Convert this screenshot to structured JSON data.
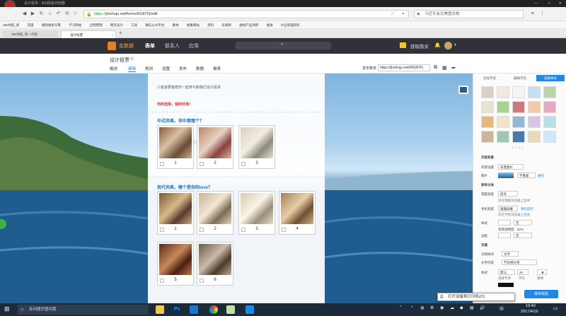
{
  "window": {
    "title": "设计投票 - 360极速浏览器"
  },
  "address": {
    "scheme": "https://",
    "url": "jinshuju.net/forms/6G87Fj/edit",
    "search_text": "习近平会见美国总统"
  },
  "bookmarks": [
    "360导航_新",
    "百度",
    "搜狗搜索引擎",
    "学习网站",
    "全网营销",
    "网页设计",
    "工具",
    "微信公众平台",
    "素材",
    "搜集网站",
    "资料",
    "乐视频",
    "虚拟产品项目",
    "金融",
    "众业管理资料"
  ],
  "tabs": [
    {
      "label": "360导航_新一代安"
    },
    {
      "label": "设计投票"
    }
  ],
  "app": {
    "logo_text": "金数据",
    "nav": [
      "表单",
      "联系人",
      "应用"
    ],
    "upgrade": "获取购买",
    "title": "设计投票",
    "subnav": [
      "概述",
      "编辑",
      "规则",
      "设置",
      "发布",
      "数据",
      "报表"
    ],
    "publish_label": "发布表单",
    "publish_url": "https://jinshuju.net/f/6G87Fj"
  },
  "form": {
    "intro": "小金家要装修你一起参与和我们设计投票",
    "notice": "你的选择，我的环境！",
    "q1": {
      "title": "中式风格，你中意哪个？",
      "options": [
        "1",
        "2",
        "3"
      ]
    },
    "q2": {
      "title": "现代风格，哪个是你的love？",
      "options": [
        "1",
        "2",
        "3",
        "4",
        "5",
        "6"
      ]
    }
  },
  "panel": {
    "tabs": [
      "添加字段",
      "编辑字段",
      "皮肤样式"
    ],
    "page_bg_title": "页面背景",
    "bg_label": "背景设置",
    "bg_value": "背景图片",
    "image_label": "图片",
    "image_mode": "不重复",
    "image_delete": "删除",
    "form_bg_title": "表单主体",
    "body_width_label": "电脑宽度",
    "body_width_value": "较窄",
    "note1": "仅在电脑浏览器上生效",
    "mobile_label": "手机宽度",
    "mobile_value": "铺满屏幕",
    "mobile_link": "预览提示",
    "note2": "仅在手机浏览器上生效",
    "style_label": "样式",
    "style_value": "无",
    "transparent_label": "背景透明度",
    "transparent_value": "50%",
    "border_label": "边框",
    "border_value": "无",
    "header_title": "页眉",
    "header_style_label": "页眉样式",
    "header_style_value": "文字",
    "text_label": "文字内容",
    "text_value": "节日特价券",
    "font_label": "样式",
    "font_value": "默认",
    "size_value": "20",
    "bold": "B",
    "sub_labels": [
      "选择字体",
      "字号",
      "粗细"
    ],
    "save": "保存皮肤"
  },
  "taskbar": {
    "search": "有问题尽管问我",
    "notification": "打开设备和打印机(O)",
    "time": "19:40",
    "date": "2017/4/19",
    "lang": "中"
  }
}
